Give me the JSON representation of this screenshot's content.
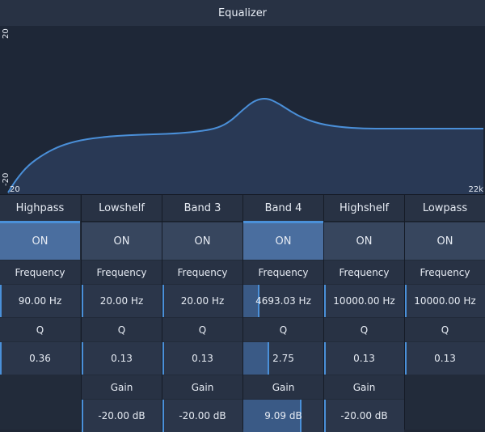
{
  "window": {
    "title": "Equalizer"
  },
  "graph": {
    "y_max_label": "20",
    "y_min_label": "-20",
    "x_min_label": "20",
    "x_max_label": "22k",
    "line_color": "#4a8fd8",
    "fill_color": "#2f4466"
  },
  "labels": {
    "frequency": "Frequency",
    "q": "Q",
    "gain": "Gain"
  },
  "bands": [
    {
      "name": "Highpass",
      "enabled": "ON",
      "active": true,
      "frequency": "90.00 Hz",
      "frequency_level": 0.0,
      "q": "0.36",
      "q_level": 0.0,
      "gain": null,
      "gain_level": null
    },
    {
      "name": "Lowshelf",
      "enabled": "ON",
      "active": false,
      "frequency": "20.00 Hz",
      "frequency_level": 0.0,
      "q": "0.13",
      "q_level": 0.0,
      "gain": "-20.00 dB",
      "gain_level": 0.0
    },
    {
      "name": "Band 3",
      "enabled": "ON",
      "active": false,
      "frequency": "20.00 Hz",
      "frequency_level": 0.0,
      "q": "0.13",
      "q_level": 0.0,
      "gain": "-20.00 dB",
      "gain_level": 0.0
    },
    {
      "name": "Band 4",
      "enabled": "ON",
      "active": true,
      "frequency": "4693.03 Hz",
      "frequency_level": 0.2,
      "q": "2.75",
      "q_level": 0.32,
      "gain": "9.09 dB",
      "gain_level": 0.73
    },
    {
      "name": "Highshelf",
      "enabled": "ON",
      "active": false,
      "frequency": "10000.00 Hz",
      "frequency_level": 0.0,
      "q": "0.13",
      "q_level": 0.0,
      "gain": "-20.00 dB",
      "gain_level": 0.0
    },
    {
      "name": "Lowpass",
      "enabled": "ON",
      "active": false,
      "frequency": "10000.00 Hz",
      "frequency_level": 0.0,
      "q": "0.13",
      "q_level": 0.0,
      "gain": null,
      "gain_level": null
    }
  ]
}
